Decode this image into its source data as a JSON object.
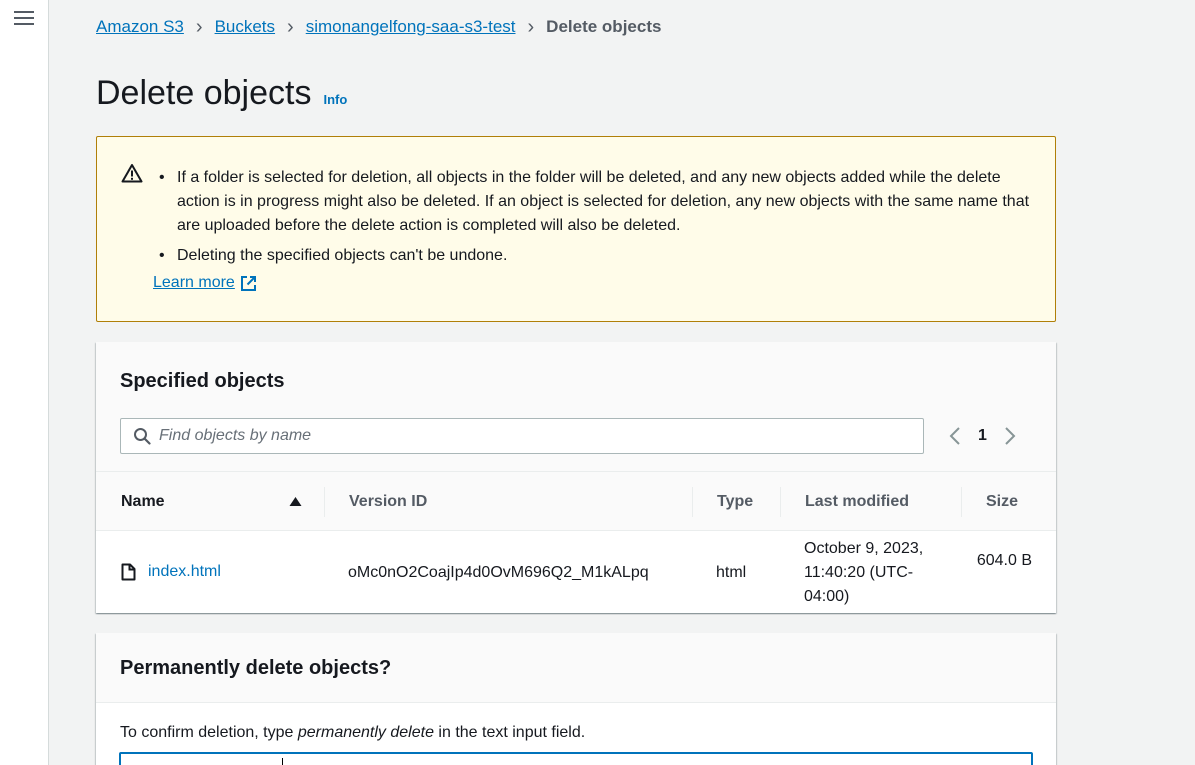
{
  "breadcrumb": {
    "items": [
      "Amazon S3",
      "Buckets",
      "simonangelfong-saa-s3-test"
    ],
    "current": "Delete objects"
  },
  "page": {
    "title": "Delete objects",
    "info_link": "Info"
  },
  "alert": {
    "bullets": [
      "If a folder is selected for deletion, all objects in the folder will be deleted, and any new objects added while the delete action is in progress might also be deleted. If an object is selected for deletion, any new objects with the same name that are uploaded before the delete action is completed will also be deleted.",
      "Deleting the specified objects can't be undone."
    ],
    "learn_more": "Learn more"
  },
  "specified_objects": {
    "title": "Specified objects",
    "search_placeholder": "Find objects by name",
    "search_value": "",
    "page_number": "1",
    "columns": [
      "Name",
      "Version ID",
      "Type",
      "Last modified",
      "Size"
    ],
    "sort_column": "Name",
    "sort_direction": "ascending",
    "rows": [
      {
        "name": "index.html",
        "version_id": "oMc0nO2CoajIp4d0OvM696Q2_M1kALpq",
        "type": "html",
        "last_modified": "October 9, 2023, 11:40:20 (UTC-04:00)",
        "size": "604.0 B"
      }
    ]
  },
  "confirm": {
    "title": "Permanently delete objects?",
    "instruction_prefix": "To confirm deletion, type ",
    "instruction_phrase": "permanently delete",
    "instruction_suffix": " in the text input field.",
    "input_value": ""
  },
  "colors": {
    "link": "#0073bb",
    "alert_background": "#fffce9",
    "alert_border": "#b07f08",
    "page_background": "#f2f3f3"
  }
}
